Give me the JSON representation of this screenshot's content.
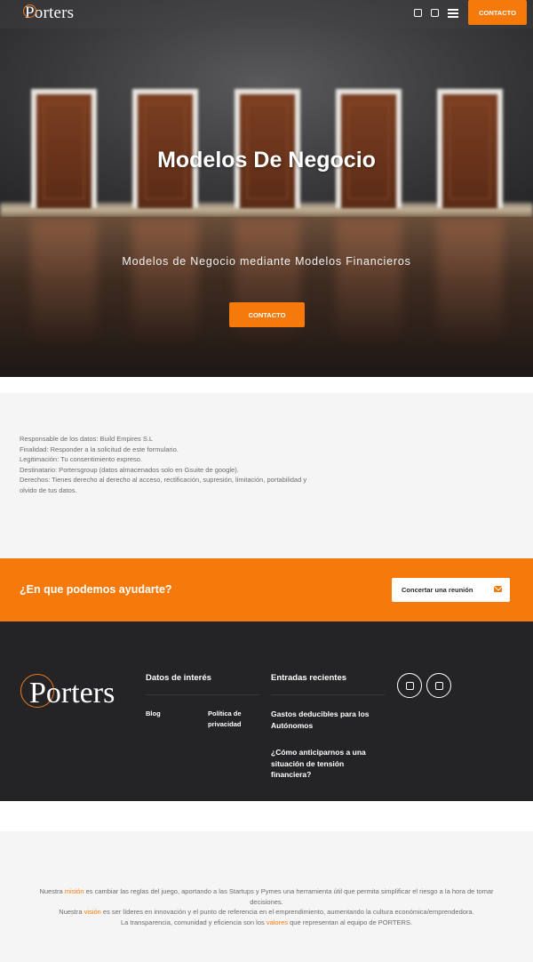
{
  "header": {
    "logo_text": "Porters",
    "contact_button": "CONTACTO",
    "icons": [
      "linkedin-icon",
      "instagram-icon",
      "menu-icon"
    ]
  },
  "hero": {
    "title": "Modelos De Negocio",
    "subtitle": "Modelos de Negocio mediante Modelos Financieros",
    "button": "CONTACTO"
  },
  "privacy": {
    "lines": [
      "Responsable de los datos: Build Empires S.L",
      "Finalidad: Responder a la solicitud de este formulario.",
      "Legitimación: Tu consentimiento expreso.",
      "Destinatario: Portersgroup (datos almacenados solo en Gsuite de google).",
      "Derechos: Tienes derecho al derecho al acceso, rectificación, supresión, limitación, portabilidad y",
      "olvido de tus datos."
    ]
  },
  "cta": {
    "question": "¿En que podemos ayudarte?",
    "button": "Concertar una reunión"
  },
  "footer": {
    "logo_text": "Porters",
    "datos_title": "Datos de interés",
    "links": [
      "Blog",
      "Política de",
      "privacidad"
    ],
    "entradas_title": "Entradas recientes",
    "posts": [
      [
        "Gastos deducibles para los",
        "Autónomos"
      ],
      [
        "¿Cómo anticiparnos a una",
        "situación de tensión",
        "financiera?"
      ]
    ],
    "social": [
      "linkedin-icon",
      "instagram-icon"
    ]
  },
  "mission": {
    "l1_a": "Nuestra ",
    "l1_b": "misión",
    "l1_c": " es cambiar las reglas del juego, aportando a las Startups y Pymes una herramienta útil que permita simplificar el riesgo a la hora de tomar decisiones.",
    "l2_a": "Nuestra ",
    "l2_b": "visión",
    "l2_c": " es ser líderes en innovación y el punto de referencia en el emprendimiento, aumentando la cultura económica/emprendedora.",
    "l3_a": "La transparencia, comunidad y eficiencia son los ",
    "l3_b": "valores",
    "l3_c": " que representan al equipo de PORTERS."
  },
  "colors": {
    "accent": "#f57a0b",
    "footer_bg": "#242426",
    "panel_bg": "#f5f5f5"
  }
}
